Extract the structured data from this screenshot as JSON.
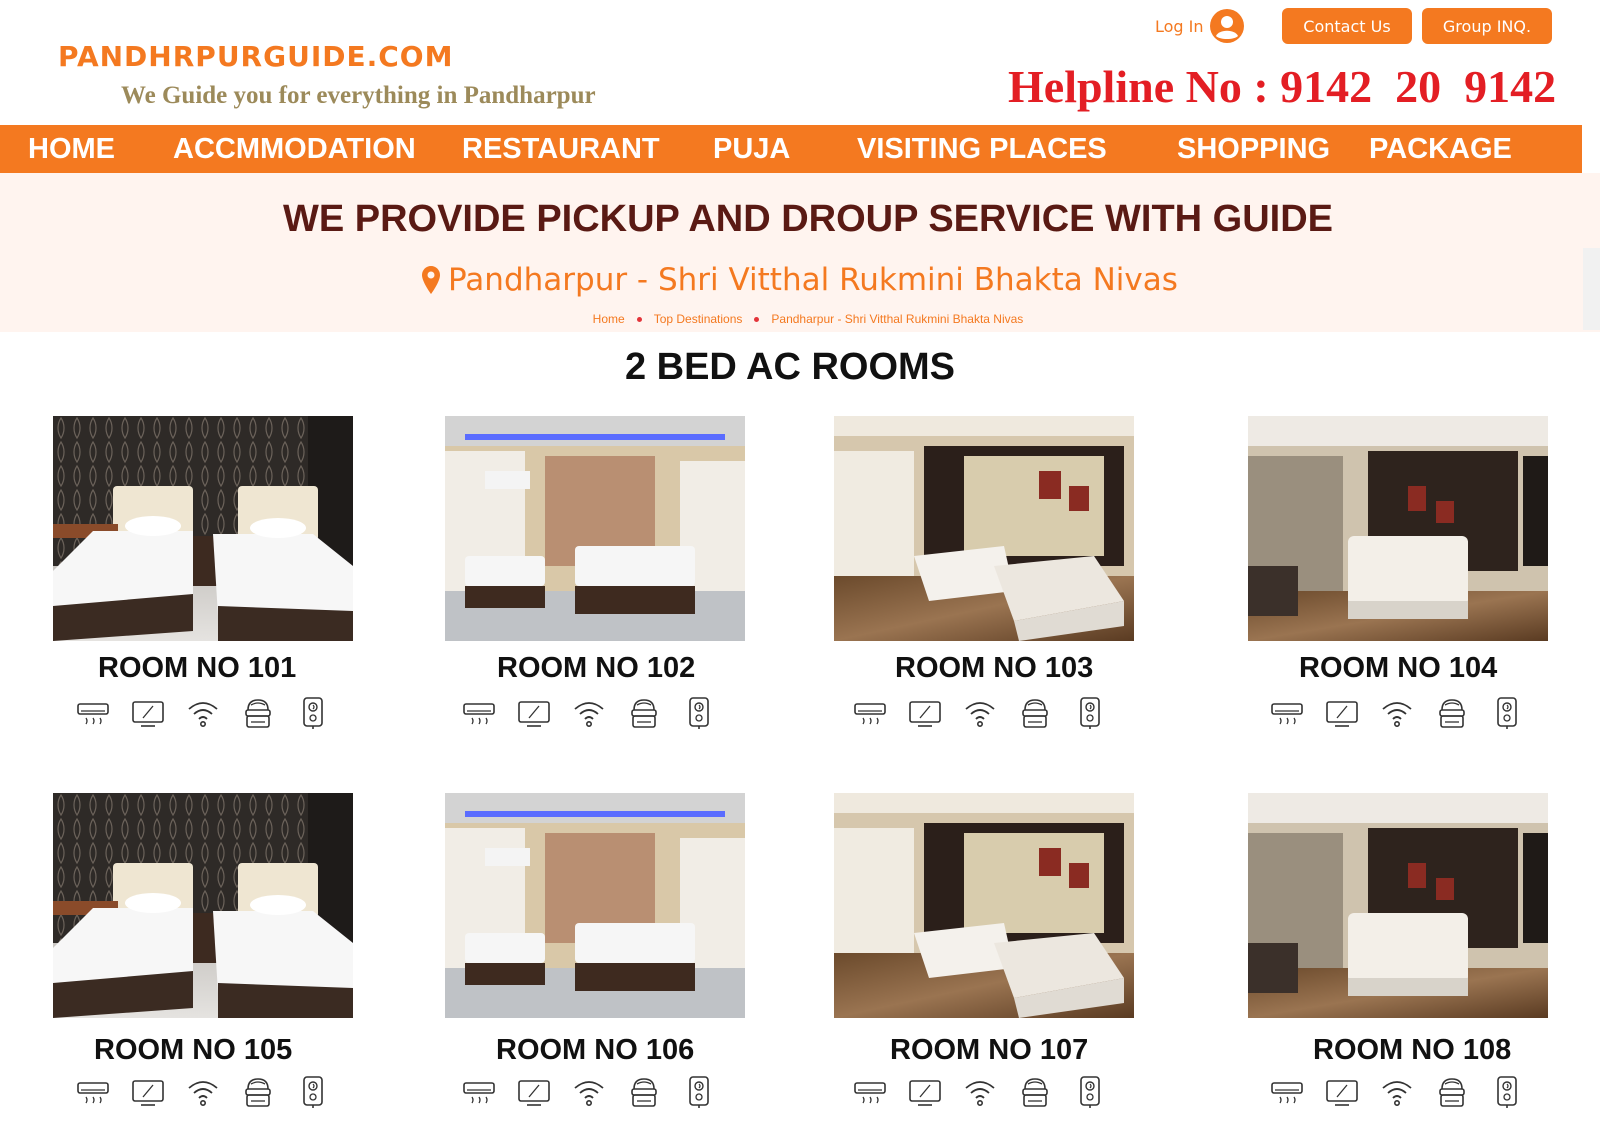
{
  "header": {
    "logo": "PANDHRPURGUIDE.COM",
    "tagline": "We Guide you for everything in Pandharpur",
    "login_label": "Log In",
    "contact_button": "Contact Us",
    "group_button": "Group INQ.",
    "helpline": "Helpline No : 9142  20  9142"
  },
  "nav": [
    "HOME",
    "ACCMMODATION",
    "RESTAURANT",
    "PUJA",
    "VISITING PLACES",
    "SHOPPING",
    "PACKAGE"
  ],
  "banner": {
    "title": "WE PROVIDE PICKUP AND DROUP SERVICE WITH GUIDE",
    "location": "Pandharpur - Shri Vitthal Rukmini Bhakta Nivas",
    "breadcrumb": [
      "Home",
      "Top Destinations",
      "Pandharpur - Shri Vitthal Rukmini Bhakta Nivas"
    ]
  },
  "section_title": "2 BED AC ROOMS",
  "rooms": [
    {
      "label": "ROOM NO 101"
    },
    {
      "label": "ROOM NO 102"
    },
    {
      "label": "ROOM NO 103"
    },
    {
      "label": "ROOM NO 104"
    },
    {
      "label": "ROOM NO 105"
    },
    {
      "label": "ROOM NO 106"
    },
    {
      "label": "ROOM NO 107"
    },
    {
      "label": "ROOM NO 108"
    }
  ],
  "amenities": [
    "air-conditioner-icon",
    "tv-icon",
    "wifi-icon",
    "kitchen-icon",
    "geyser-icon"
  ],
  "colors": {
    "brand": "#f47920",
    "helpline": "#e31e24",
    "banner_bg": "#fff4ef",
    "banner_title": "#5a1a14"
  }
}
